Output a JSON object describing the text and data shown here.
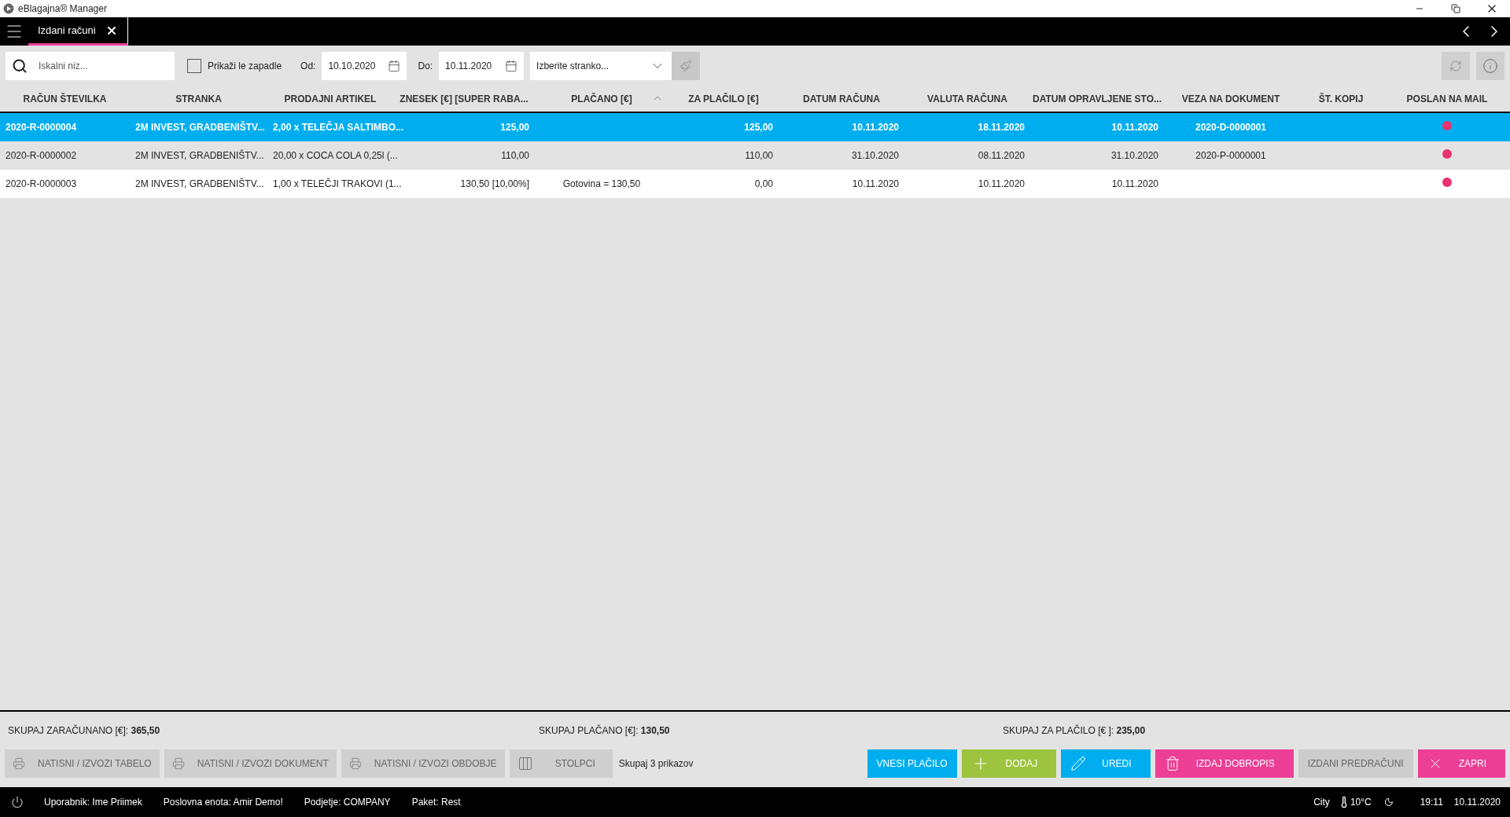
{
  "window": {
    "title": "eBlagajna® Manager"
  },
  "tabs": [
    {
      "label": "Izdani računi",
      "selected": true
    }
  ],
  "toolbar": {
    "search": {
      "placeholder": "Iskalni niz..."
    },
    "overdue": {
      "label": "Prikaži le zapadle",
      "checked": false
    },
    "from": {
      "label": "Od:",
      "value": "10.10.2020"
    },
    "to": {
      "label": "Do:",
      "value": "10.11.2020"
    },
    "customer": {
      "placeholder": "Izberite stranko..."
    }
  },
  "table": {
    "columns": [
      {
        "label": "RAČUN ŠTEVILKA",
        "sorted": false
      },
      {
        "label": "STRANKA",
        "sorted": false
      },
      {
        "label": "PRODAJNI ARTIKEL",
        "sorted": false
      },
      {
        "label": "ZNESEK [€] [SUPER RABA...",
        "sorted": false
      },
      {
        "label": "PLAČANO [€]",
        "sorted": true
      },
      {
        "label": "ZA PLAČILO [€]",
        "sorted": false
      },
      {
        "label": "DATUM RAČUNA",
        "sorted": false
      },
      {
        "label": "VALUTA RAČUNA",
        "sorted": false
      },
      {
        "label": "DATUM OPRAVLJENE STO...",
        "sorted": false
      },
      {
        "label": "VEZA NA DOKUMENT",
        "sorted": false
      },
      {
        "label": "ŠT. KOPIJ",
        "sorted": false
      },
      {
        "label": "POSLAN NA MAIL",
        "sorted": false
      }
    ],
    "rows": [
      {
        "selected": true,
        "color": "#e8336e",
        "cells": [
          "2020-R-0000004",
          "2M INVEST, GRADBENIŠTV...",
          "2,00 x TELEČJA SALTIMBO...",
          "125,00",
          "",
          "125,00",
          "10.11.2020",
          "18.11.2020",
          "10.11.2020",
          "2020-D-0000001",
          ""
        ]
      },
      {
        "selected": false,
        "color": "#e8336e",
        "cells": [
          "2020-R-0000002",
          "2M INVEST, GRADBENIŠTV...",
          "20,00 x COCA COLA 0,25l (...",
          "110,00",
          "",
          "110,00",
          "31.10.2020",
          "08.11.2020",
          "31.10.2020",
          "2020-P-0000001",
          ""
        ]
      },
      {
        "selected": false,
        "color": "#e8336e",
        "cells": [
          "2020-R-0000003",
          "2M INVEST, GRADBENIŠTV...",
          "1,00 x TELEČJI TRAKOVI (1...",
          "130,50 [10,00%]",
          "Gotovina = 130,50",
          "0,00",
          "10.11.2020",
          "10.11.2020",
          "10.11.2020",
          "",
          ""
        ]
      }
    ]
  },
  "totals": [
    {
      "label": "SKUPAJ ZARAČUNANO [€]:",
      "value": "365,50"
    },
    {
      "label": "SKUPAJ PLAČANO [€]:",
      "value": "130,50"
    },
    {
      "label": "SKUPAJ ZA PLAČILO [€ ]:",
      "value": "235,00"
    }
  ],
  "left_buttons": [
    {
      "kind": "print",
      "label": "NATISNI / IZVOZI TABELO"
    },
    {
      "kind": "print",
      "label": "NATISNI / IZVOZI DOKUMENT"
    },
    {
      "kind": "print",
      "label": "NATISNI / IZVOZI OBDOBJE"
    },
    {
      "kind": "columns",
      "label": "STOLPCI"
    }
  ],
  "count_text": "Skupaj 3 prikazov",
  "action_buttons": [
    {
      "kind": "plain",
      "label": "VNESI PLAČILO",
      "color": "#00aeef"
    },
    {
      "kind": "plus",
      "label": "DODAJ",
      "color": "#9dc43f"
    },
    {
      "kind": "pencil",
      "label": "UREDI",
      "color": "#00aeef"
    },
    {
      "kind": "trash",
      "label": "IZDAJ DOBROPIS",
      "color": "#ec3f95"
    },
    {
      "kind": "plain",
      "label": "IZDANI PREDRAČUNI",
      "color": "#cccccc"
    },
    {
      "kind": "close",
      "label": "ZAPRI",
      "color": "#ec3f95"
    }
  ],
  "status_bar": {
    "items": [
      "Uporabnik: Ime Priimek",
      "Poslovna enota: Amir Demo!",
      "Podjetje: COMPANY",
      "Paket: Rest"
    ],
    "city": "City",
    "temperature": "10°C",
    "time": "19:11",
    "date": "10.11.2020"
  }
}
